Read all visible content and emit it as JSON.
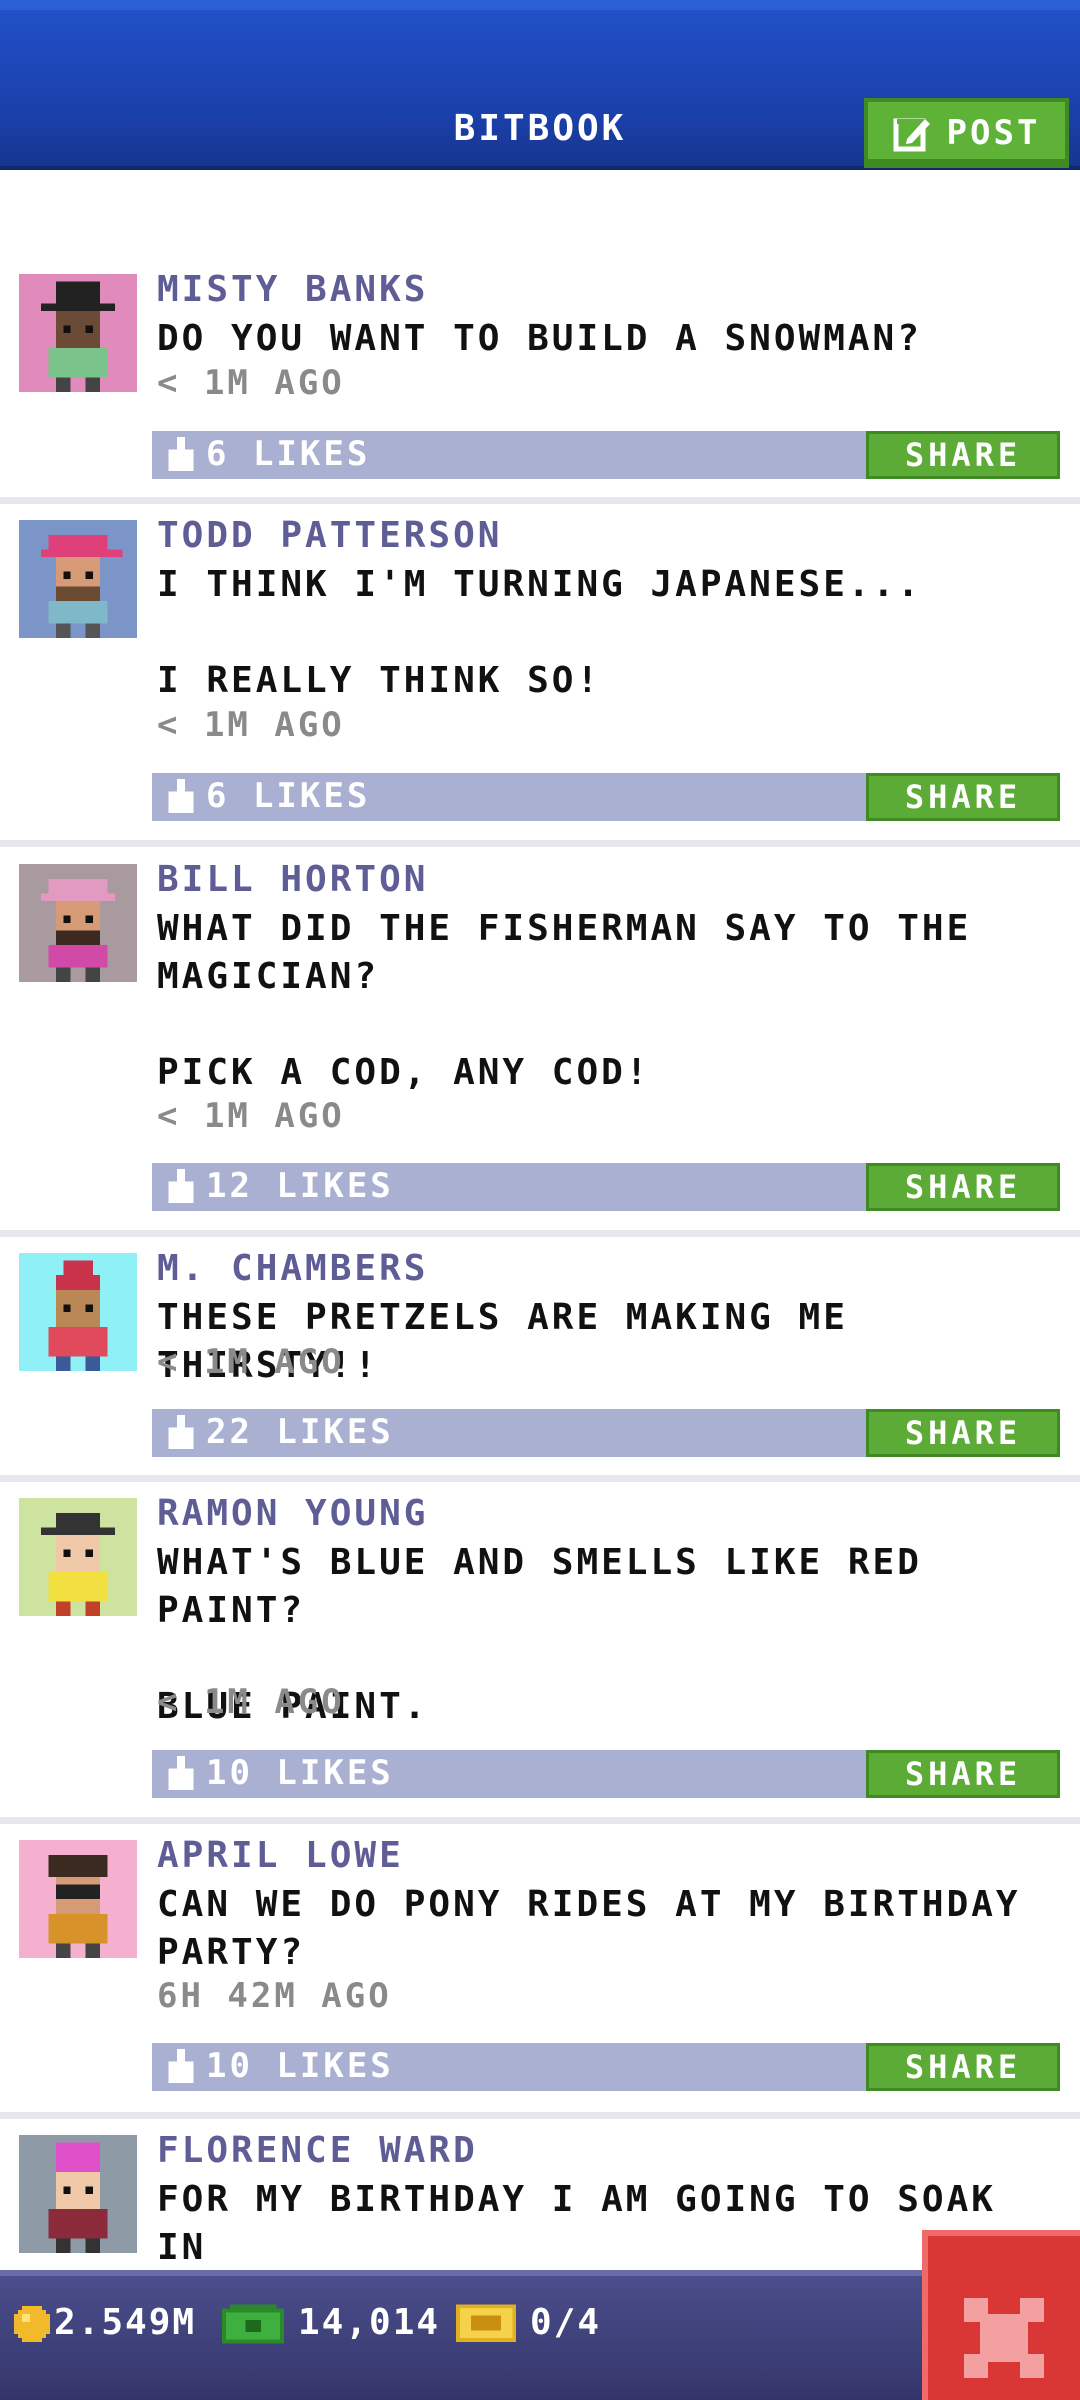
{
  "header": {
    "title": "BITBOOK",
    "post_label": "POST"
  },
  "colors": {
    "header_blue": "#1a3fa8",
    "author": "#5e5d96",
    "like_bar": "#aab0d2",
    "share_green": "#5cab36",
    "close_red": "#d93636"
  },
  "share_label": "SHARE",
  "posts": [
    {
      "author": "MISTY BANKS",
      "message": "DO YOU WANT TO BUILD A SNOWMAN?",
      "time": "< 1M AGO",
      "likes": "6 LIKES",
      "avatar_bg": "#e08bbc"
    },
    {
      "author": "TODD PATTERSON",
      "message": "I THINK I'M TURNING JAPANESE...\n\nI REALLY THINK SO!",
      "time": "< 1M AGO",
      "likes": "6 LIKES",
      "avatar_bg": "#7b95c9"
    },
    {
      "author": "BILL HORTON",
      "message": "WHAT DID THE FISHERMAN SAY TO THE\nMAGICIAN?\n\nPICK A COD, ANY COD!",
      "time": "< 1M AGO",
      "likes": "12 LIKES",
      "avatar_bg": "#a89a9e"
    },
    {
      "author": "M. CHAMBERS",
      "message": "THESE PRETZELS ARE MAKING ME THIRSTY!!",
      "time": "< 1M AGO",
      "likes": "22 LIKES",
      "avatar_bg": "#8ff0f5"
    },
    {
      "author": "RAMON YOUNG",
      "message": "WHAT'S BLUE AND SMELLS LIKE RED PAINT?\n\nBLUE PAINT.",
      "time": "< 1M AGO",
      "likes": "10 LIKES",
      "avatar_bg": "#cfe3a0"
    },
    {
      "author": "APRIL LOWE",
      "message": "CAN WE DO PONY RIDES AT MY BIRTHDAY\nPARTY?",
      "time": "6H 42M AGO",
      "likes": "10 LIKES",
      "avatar_bg": "#f5b0cf"
    },
    {
      "author": "FLORENCE WARD",
      "message": "FOR MY BIRTHDAY I AM GOING TO SOAK IN\nTHE TUB AND READ A BOOK.",
      "time": "",
      "likes": "",
      "avatar_bg": "#8e9aa6"
    }
  ],
  "footer": {
    "coins": "2.549M",
    "bux": "14,014",
    "tickets": "0/4"
  }
}
